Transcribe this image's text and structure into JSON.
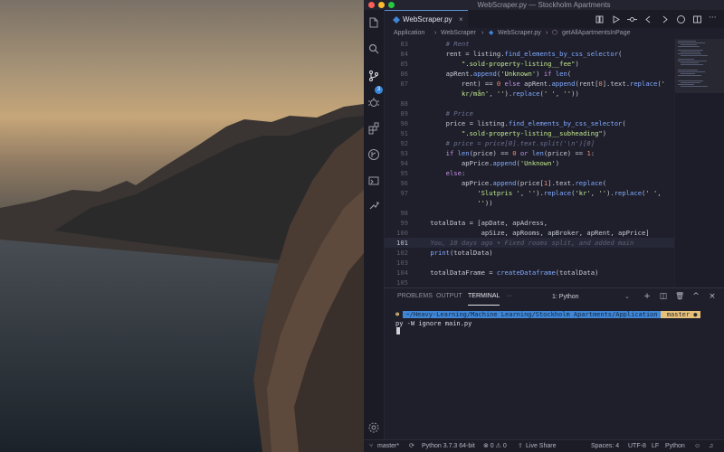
{
  "window": {
    "title": "WebScraper.py — Stockholm Apartments"
  },
  "tab": {
    "label": "WebScraper.py",
    "close": "×"
  },
  "breadcrumb": [
    "Application",
    "WebScraper",
    "WebScraper.py",
    "getAllApartmentsInPage"
  ],
  "activity": {
    "scm_badge": "3"
  },
  "code_lines": [
    {
      "n": "83",
      "html": "        <span class=\"c\"># Rent</span>"
    },
    {
      "n": "84",
      "html": "        rent = listing.<span class=\"f\">find_elements_by_css_selector</span>("
    },
    {
      "n": "85",
      "html": "            <span class=\"s\">\".sold-property-listing__fee\"</span>)"
    },
    {
      "n": "86",
      "html": "        apRent.<span class=\"f\">append</span>(<span class=\"s\">'Unknown'</span>) <span class=\"k\">if</span> <span class=\"f\">len</span>("
    },
    {
      "n": "87",
      "html": "            rent) == <span class=\"n\">0</span> <span class=\"k\">else</span> apRent.<span class=\"f\">append</span>(rent[<span class=\"n\">0</span>].text.<span class=\"f\">replace</span>(<span class=\"s\">'</span>"
    },
    {
      "n": "",
      "html": "            <span class=\"s\">kr/mån'</span>, <span class=\"s\">''</span>).<span class=\"f\">replace</span>(<span class=\"s\">' '</span>, <span class=\"s\">''</span>))"
    },
    {
      "n": "88",
      "html": ""
    },
    {
      "n": "89",
      "html": "        <span class=\"c\"># Price</span>"
    },
    {
      "n": "90",
      "html": "        price = listing.<span class=\"f\">find_elements_by_css_selector</span>("
    },
    {
      "n": "91",
      "html": "            <span class=\"s\">\".sold-property-listing__subheading\"</span>)"
    },
    {
      "n": "92",
      "html": "        <span class=\"c\"># price = price[0].text.split('\\n')[0]</span>"
    },
    {
      "n": "93",
      "html": "        <span class=\"k\">if</span> <span class=\"f\">len</span>(price) == <span class=\"n\">0</span> <span class=\"k\">or</span> <span class=\"f\">len</span>(price) == <span class=\"n\">1</span>:"
    },
    {
      "n": "94",
      "html": "            apPrice.<span class=\"f\">append</span>(<span class=\"s\">'Unknown'</span>)"
    },
    {
      "n": "95",
      "html": "        <span class=\"k\">else</span>:"
    },
    {
      "n": "96",
      "html": "            apPrice.<span class=\"f\">append</span>(price[<span class=\"n\">1</span>].text.<span class=\"f\">replace</span>("
    },
    {
      "n": "97",
      "html": "                <span class=\"s\">'Slutpris '</span>, <span class=\"s\">''</span>).<span class=\"f\">replace</span>(<span class=\"s\">'kr'</span>, <span class=\"s\">''</span>).<span class=\"f\">replace</span>(<span class=\"s\">' '</span>,"
    },
    {
      "n": "",
      "html": "                <span class=\"s\">''</span>))"
    },
    {
      "n": "98",
      "html": ""
    },
    {
      "n": "99",
      "html": "    totalData = [apDate, apAdress,"
    },
    {
      "n": "100",
      "html": "                 apSize, apRooms, apBroker, apRent, apPrice]"
    },
    {
      "n": "101",
      "html": "    <span class=\"blame\">You, 10 days ago • Fixed rooms split, and added main</span>",
      "current": true
    },
    {
      "n": "102",
      "html": "    <span class=\"f\">print</span>(totalData)"
    },
    {
      "n": "103",
      "html": ""
    },
    {
      "n": "104",
      "html": "    totalDataFrame = <span class=\"f\">createDataframe</span>(totalData)"
    },
    {
      "n": "105",
      "html": ""
    }
  ],
  "panel": {
    "tabs": [
      "PROBLEMS",
      "OUTPUT",
      "TERMINAL",
      "···"
    ],
    "terminal_select": "1: Python",
    "buttons": {
      "add": "+",
      "split": "◫",
      "trash": "🗑",
      "maximize": "^",
      "close": "×"
    }
  },
  "terminal": {
    "prompt_icon": "☻",
    "path": "~/Heavy-Learning/Machine Learning/Stockholm Apartments/Application",
    "branch": " master ●",
    "command": "py -W ignore main.py"
  },
  "status": {
    "branch": "master*",
    "python": "Python 3.7.3 64-bit",
    "errors": "⊗ 0 ⚠ 0",
    "liveshare": "Live Share",
    "spaces": "Spaces: 4",
    "encoding": "UTF-8",
    "eol": "LF",
    "language": "Python"
  },
  "colors": {
    "accent": "#3f86d6",
    "branch_yellow": "#e6c07b",
    "editor_bg": "#1e1f2b"
  }
}
